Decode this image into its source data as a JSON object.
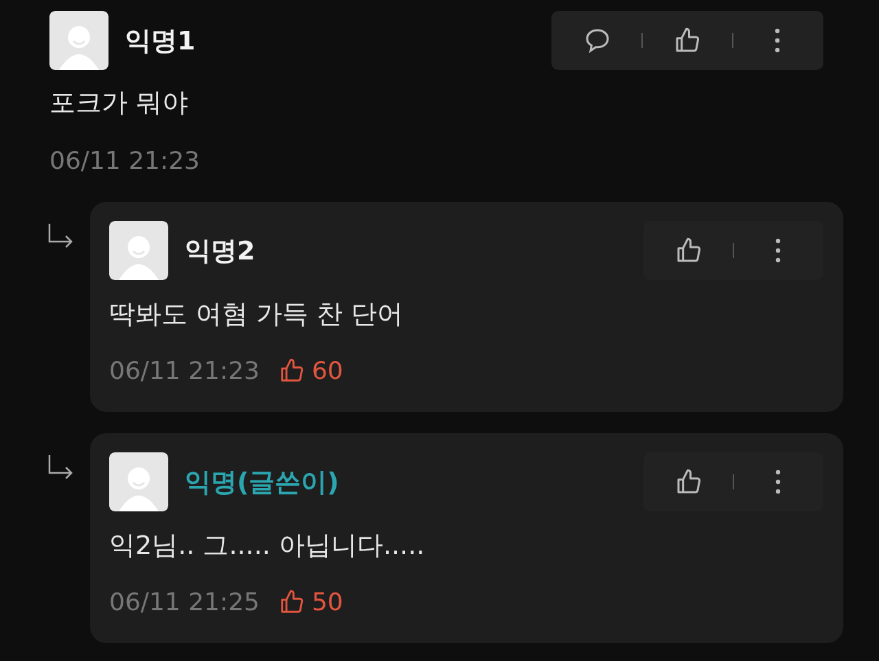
{
  "comment": {
    "author": "익명1",
    "writer": false,
    "text": "포크가 뭐야",
    "time": "06/11 21:23",
    "actions": [
      {
        "kind": "comment"
      },
      {
        "kind": "like"
      },
      {
        "kind": "more"
      }
    ]
  },
  "replies": [
    {
      "author": "익명2",
      "writer": false,
      "text": "딱봐도 여혐 가득 찬 단어",
      "time": "06/11 21:23",
      "likes": "60",
      "actions": [
        {
          "kind": "like"
        },
        {
          "kind": "more"
        }
      ]
    },
    {
      "author": "익명(글쓴이)",
      "writer": true,
      "text": "익2님.. 그..... 아닙니다.....",
      "time": "06/11 21:25",
      "likes": "50",
      "actions": [
        {
          "kind": "like"
        },
        {
          "kind": "more"
        }
      ]
    }
  ]
}
